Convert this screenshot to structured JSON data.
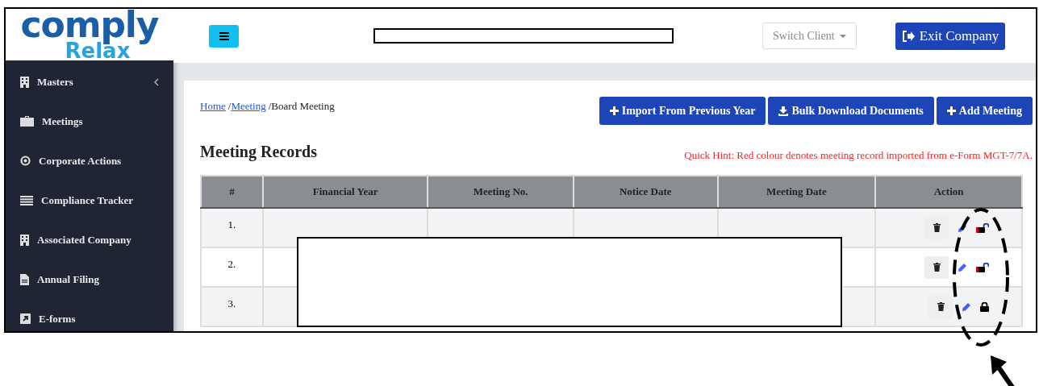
{
  "logo": {
    "line1": "comply",
    "line2": "Relax"
  },
  "header": {
    "switch_client": "Switch Client",
    "exit_button": "Exit Company"
  },
  "sidebar": {
    "items": [
      {
        "label": "Masters",
        "kind": "building",
        "expandable": true
      },
      {
        "label": "Meetings",
        "kind": "briefcase",
        "expandable": false
      },
      {
        "label": "Corporate Actions",
        "kind": "circle",
        "expandable": false
      },
      {
        "label": "Compliance Tracker",
        "kind": "list",
        "expandable": false
      },
      {
        "label": "Associated Company",
        "kind": "building",
        "expandable": false
      },
      {
        "label": "Annual Filing",
        "kind": "file",
        "expandable": false
      },
      {
        "label": "E-forms",
        "kind": "external",
        "expandable": false
      }
    ]
  },
  "breadcrumb": [
    {
      "label": "Home",
      "kind": "link"
    },
    {
      "label": "/",
      "kind": "separator"
    },
    {
      "label": "Meeting",
      "kind": "link"
    },
    {
      "label": "/",
      "kind": "separator"
    },
    {
      "label": "Board Meeting",
      "kind": "current"
    }
  ],
  "actions": [
    {
      "label": "Import From Previous Year",
      "kind": "plus"
    },
    {
      "label": "Bulk Download Documents",
      "kind": "download"
    },
    {
      "label": "Add Meeting",
      "kind": "plus"
    }
  ],
  "section_title": "Meeting Records",
  "hint": "Quick Hint: Red colour denotes meeting record imported from e-Form MGT-7/7A.",
  "table": {
    "columns": [
      "#",
      "Financial Year",
      "Meeting No.",
      "Notice Date",
      "Meeting Date",
      "Action"
    ],
    "rows": [
      {
        "number": "1.",
        "locked": false
      },
      {
        "number": "2.",
        "locked": false
      },
      {
        "number": "3.",
        "locked": true
      }
    ]
  }
}
